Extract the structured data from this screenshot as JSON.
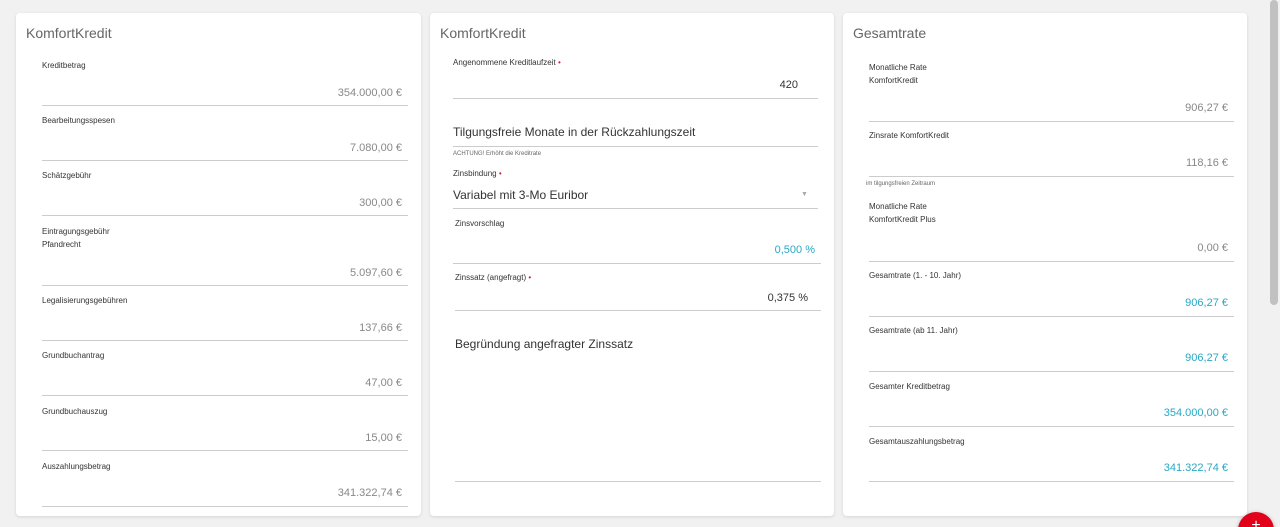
{
  "card1": {
    "title": "KomfortKredit",
    "fields": [
      {
        "label": "Kreditbetrag",
        "value": "354.000,00 €"
      },
      {
        "label": "Bearbeitungsspesen",
        "value": "7.080,00 €"
      },
      {
        "label": "Schätzgebühr",
        "value": "300,00 €"
      },
      {
        "label": "Eintragungsgebühr",
        "label2": "Pfandrecht",
        "value": "5.097,60 €"
      },
      {
        "label": "Legalisierungsgebühren",
        "value": "137,66 €"
      },
      {
        "label": "Grundbuchantrag",
        "value": "47,00 €"
      },
      {
        "label": "Grundbuchauszug",
        "value": "15,00 €"
      },
      {
        "label": "Auszahlungsbetrag",
        "value": "341.322,74 €"
      }
    ]
  },
  "card2": {
    "title": "KomfortKredit",
    "laufzeit_label": "Angenommene Kreditlaufzeit",
    "laufzeit_value": "420",
    "tilgungsfrei_label": "Tilgungsfreie Monate in der Rückzahlungszeit",
    "achtung_note": "ACHTUNG! Erhöht die Kreditrate",
    "zinsbindung_label": "Zinsbindung",
    "zinsbindung_value": "Variabel mit 3-Mo Euribor",
    "zinsvorschlag_label": "Zinsvorschlag",
    "zinsvorschlag_value": "0,500 %",
    "zinssatz_label": "Zinssatz (angefragt)",
    "zinssatz_value": "0,375 %",
    "begruendung_label": "Begründung angefragter Zinssatz",
    "required_marker": "•"
  },
  "card3": {
    "title": "Gesamtrate",
    "rate_label_1": "Monatliche Rate",
    "rate_label_2": "KomfortKredit",
    "rate_value": "906,27 €",
    "zinsrate_label": "Zinsrate KomfortKredit",
    "zinsrate_value": "118,16 €",
    "zinsrate_note": "im tilgungsfreien Zeitraum",
    "plus_label_1": "Monatliche Rate",
    "plus_label_2": "KomfortKredit Plus",
    "plus_value": "0,00 €",
    "gesamt1_label": "Gesamtrate (1. - 10. Jahr)",
    "gesamt1_value": "906,27 €",
    "gesamt2_label": "Gesamtrate (ab 11. Jahr)",
    "gesamt2_value": "906,27 €",
    "kreditbetrag_label": "Gesamter Kreditbetrag",
    "kreditbetrag_value": "354.000,00 €",
    "auszahlung_label": "Gesamtauszahlungsbetrag",
    "auszahlung_value": "341.322,74 €"
  },
  "colors": {
    "accent": "#29a8c6",
    "brand": "#e3001b",
    "required": "#d51d34"
  }
}
